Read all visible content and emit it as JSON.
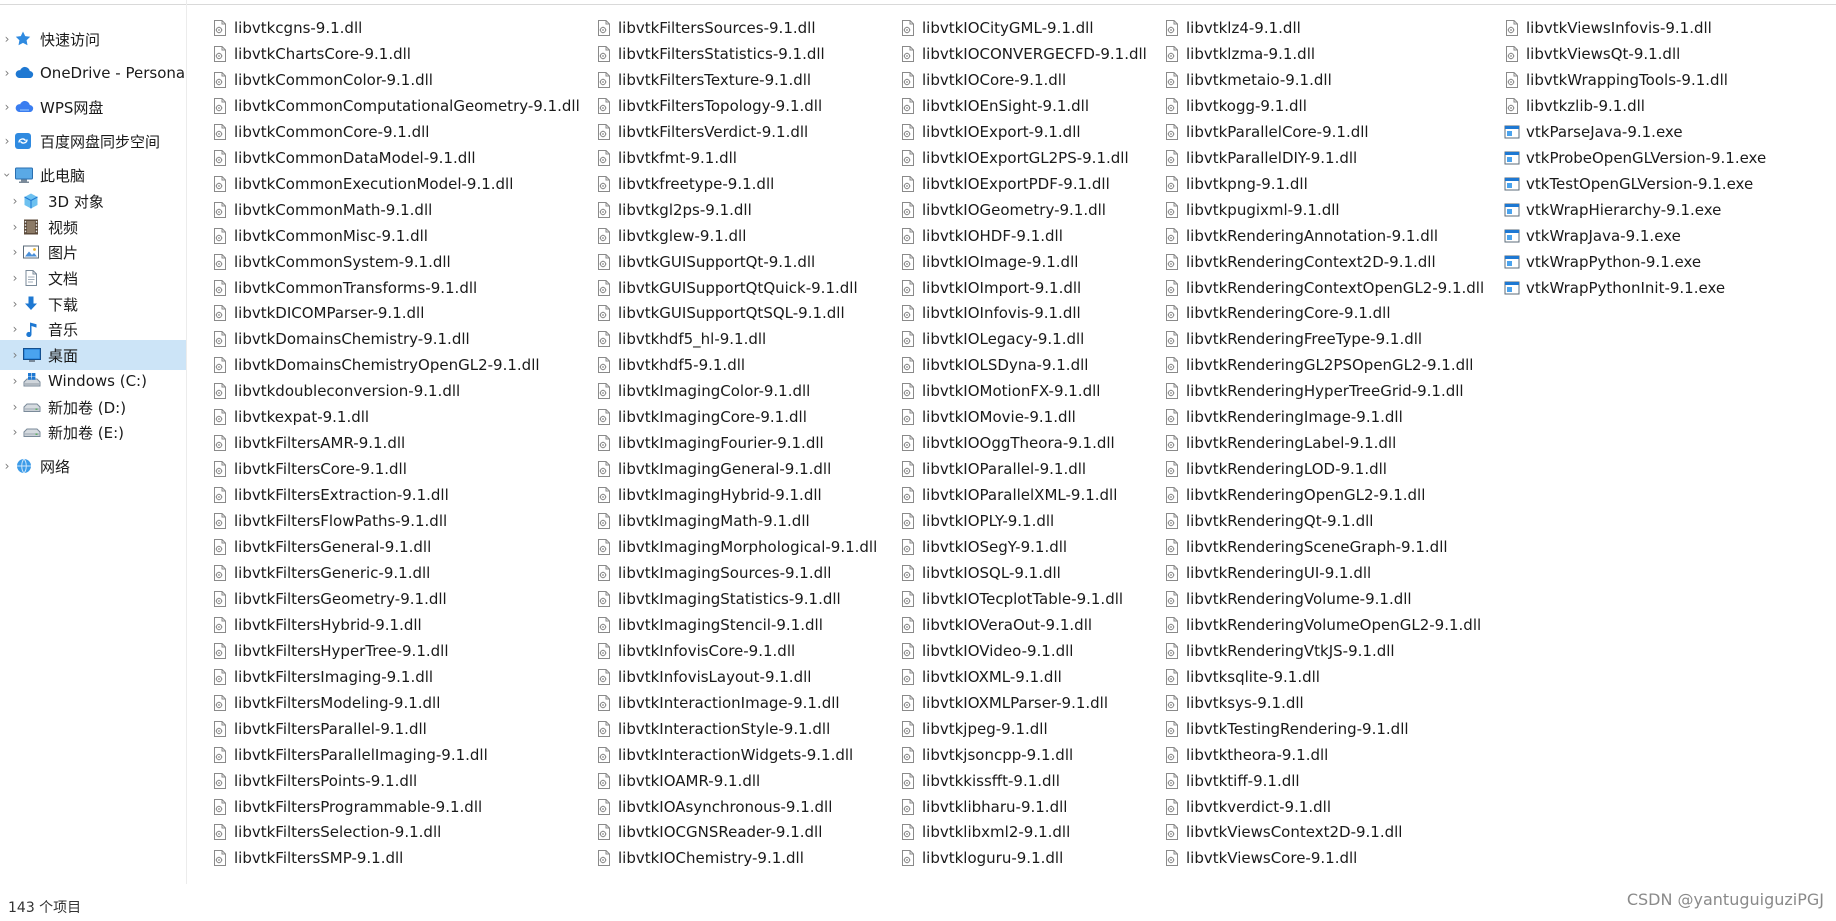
{
  "colors": {
    "selected_bg": "#cce4f7",
    "accent_blue": "#1e78d2",
    "text": "#1a1a1a",
    "watermark": "#8a8a8a"
  },
  "sidebar": {
    "items": [
      {
        "label": "快速访问",
        "icon": "star-icon",
        "expander": true,
        "expanded": false,
        "indent": 0,
        "selected": false
      },
      {
        "label": "OneDrive - Persona",
        "icon": "cloud-icon",
        "expander": true,
        "expanded": false,
        "indent": 0,
        "selected": false
      },
      {
        "label": "WPS网盘",
        "icon": "wps-cloud-icon",
        "expander": true,
        "expanded": false,
        "indent": 0,
        "selected": false
      },
      {
        "label": "百度网盘同步空间",
        "icon": "baidu-sync-icon",
        "expander": true,
        "expanded": false,
        "indent": 0,
        "selected": false
      },
      {
        "label": "此电脑",
        "icon": "computer-icon",
        "expander": true,
        "expanded": true,
        "indent": 0,
        "selected": false
      },
      {
        "label": "3D 对象",
        "icon": "cube-icon",
        "expander": true,
        "expanded": false,
        "indent": 1,
        "selected": false
      },
      {
        "label": "视频",
        "icon": "film-icon",
        "expander": true,
        "expanded": false,
        "indent": 1,
        "selected": false
      },
      {
        "label": "图片",
        "icon": "picture-icon",
        "expander": true,
        "expanded": false,
        "indent": 1,
        "selected": false
      },
      {
        "label": "文档",
        "icon": "document-icon",
        "expander": true,
        "expanded": false,
        "indent": 1,
        "selected": false
      },
      {
        "label": "下载",
        "icon": "download-arrow-icon",
        "expander": true,
        "expanded": false,
        "indent": 1,
        "selected": false
      },
      {
        "label": "音乐",
        "icon": "music-note-icon",
        "expander": true,
        "expanded": false,
        "indent": 1,
        "selected": false
      },
      {
        "label": "桌面",
        "icon": "desktop-icon",
        "expander": true,
        "expanded": false,
        "indent": 1,
        "selected": true
      },
      {
        "label": "Windows (C:)",
        "icon": "windows-drive-icon",
        "expander": true,
        "expanded": false,
        "indent": 1,
        "selected": false
      },
      {
        "label": "新加卷 (D:)",
        "icon": "drive-icon",
        "expander": true,
        "expanded": false,
        "indent": 1,
        "selected": false
      },
      {
        "label": "新加卷 (E:)",
        "icon": "drive-icon",
        "expander": true,
        "expanded": false,
        "indent": 1,
        "selected": false
      },
      {
        "label": "网络",
        "icon": "network-icon",
        "expander": true,
        "expanded": false,
        "indent": 0,
        "selected": false
      }
    ]
  },
  "files": {
    "columns": [
      [
        {
          "name": "libvtkcgns-9.1.dll",
          "type": "dll"
        },
        {
          "name": "libvtkChartsCore-9.1.dll",
          "type": "dll"
        },
        {
          "name": "libvtkCommonColor-9.1.dll",
          "type": "dll"
        },
        {
          "name": "libvtkCommonComputationalGeometry-9.1.dll",
          "type": "dll"
        },
        {
          "name": "libvtkCommonCore-9.1.dll",
          "type": "dll"
        },
        {
          "name": "libvtkCommonDataModel-9.1.dll",
          "type": "dll"
        },
        {
          "name": "libvtkCommonExecutionModel-9.1.dll",
          "type": "dll"
        },
        {
          "name": "libvtkCommonMath-9.1.dll",
          "type": "dll"
        },
        {
          "name": "libvtkCommonMisc-9.1.dll",
          "type": "dll"
        },
        {
          "name": "libvtkCommonSystem-9.1.dll",
          "type": "dll"
        },
        {
          "name": "libvtkCommonTransforms-9.1.dll",
          "type": "dll"
        },
        {
          "name": "libvtkDICOMParser-9.1.dll",
          "type": "dll"
        },
        {
          "name": "libvtkDomainsChemistry-9.1.dll",
          "type": "dll"
        },
        {
          "name": "libvtkDomainsChemistryOpenGL2-9.1.dll",
          "type": "dll"
        },
        {
          "name": "libvtkdoubleconversion-9.1.dll",
          "type": "dll"
        },
        {
          "name": "libvtkexpat-9.1.dll",
          "type": "dll"
        },
        {
          "name": "libvtkFiltersAMR-9.1.dll",
          "type": "dll"
        },
        {
          "name": "libvtkFiltersCore-9.1.dll",
          "type": "dll"
        },
        {
          "name": "libvtkFiltersExtraction-9.1.dll",
          "type": "dll"
        },
        {
          "name": "libvtkFiltersFlowPaths-9.1.dll",
          "type": "dll"
        },
        {
          "name": "libvtkFiltersGeneral-9.1.dll",
          "type": "dll"
        },
        {
          "name": "libvtkFiltersGeneric-9.1.dll",
          "type": "dll"
        },
        {
          "name": "libvtkFiltersGeometry-9.1.dll",
          "type": "dll"
        },
        {
          "name": "libvtkFiltersHybrid-9.1.dll",
          "type": "dll"
        },
        {
          "name": "libvtkFiltersHyperTree-9.1.dll",
          "type": "dll"
        },
        {
          "name": "libvtkFiltersImaging-9.1.dll",
          "type": "dll"
        },
        {
          "name": "libvtkFiltersModeling-9.1.dll",
          "type": "dll"
        },
        {
          "name": "libvtkFiltersParallel-9.1.dll",
          "type": "dll"
        },
        {
          "name": "libvtkFiltersParallelImaging-9.1.dll",
          "type": "dll"
        },
        {
          "name": "libvtkFiltersPoints-9.1.dll",
          "type": "dll"
        },
        {
          "name": "libvtkFiltersProgrammable-9.1.dll",
          "type": "dll"
        },
        {
          "name": "libvtkFiltersSelection-9.1.dll",
          "type": "dll"
        },
        {
          "name": "libvtkFiltersSMP-9.1.dll",
          "type": "dll"
        }
      ],
      [
        {
          "name": "libvtkFiltersSources-9.1.dll",
          "type": "dll"
        },
        {
          "name": "libvtkFiltersStatistics-9.1.dll",
          "type": "dll"
        },
        {
          "name": "libvtkFiltersTexture-9.1.dll",
          "type": "dll"
        },
        {
          "name": "libvtkFiltersTopology-9.1.dll",
          "type": "dll"
        },
        {
          "name": "libvtkFiltersVerdict-9.1.dll",
          "type": "dll"
        },
        {
          "name": "libvtkfmt-9.1.dll",
          "type": "dll"
        },
        {
          "name": "libvtkfreetype-9.1.dll",
          "type": "dll"
        },
        {
          "name": "libvtkgl2ps-9.1.dll",
          "type": "dll"
        },
        {
          "name": "libvtkglew-9.1.dll",
          "type": "dll"
        },
        {
          "name": "libvtkGUISupportQt-9.1.dll",
          "type": "dll"
        },
        {
          "name": "libvtkGUISupportQtQuick-9.1.dll",
          "type": "dll"
        },
        {
          "name": "libvtkGUISupportQtSQL-9.1.dll",
          "type": "dll"
        },
        {
          "name": "libvtkhdf5_hl-9.1.dll",
          "type": "dll"
        },
        {
          "name": "libvtkhdf5-9.1.dll",
          "type": "dll"
        },
        {
          "name": "libvtkImagingColor-9.1.dll",
          "type": "dll"
        },
        {
          "name": "libvtkImagingCore-9.1.dll",
          "type": "dll"
        },
        {
          "name": "libvtkImagingFourier-9.1.dll",
          "type": "dll"
        },
        {
          "name": "libvtkImagingGeneral-9.1.dll",
          "type": "dll"
        },
        {
          "name": "libvtkImagingHybrid-9.1.dll",
          "type": "dll"
        },
        {
          "name": "libvtkImagingMath-9.1.dll",
          "type": "dll"
        },
        {
          "name": "libvtkImagingMorphological-9.1.dll",
          "type": "dll"
        },
        {
          "name": "libvtkImagingSources-9.1.dll",
          "type": "dll"
        },
        {
          "name": "libvtkImagingStatistics-9.1.dll",
          "type": "dll"
        },
        {
          "name": "libvtkImagingStencil-9.1.dll",
          "type": "dll"
        },
        {
          "name": "libvtkInfovisCore-9.1.dll",
          "type": "dll"
        },
        {
          "name": "libvtkInfovisLayout-9.1.dll",
          "type": "dll"
        },
        {
          "name": "libvtkInteractionImage-9.1.dll",
          "type": "dll"
        },
        {
          "name": "libvtkInteractionStyle-9.1.dll",
          "type": "dll"
        },
        {
          "name": "libvtkInteractionWidgets-9.1.dll",
          "type": "dll"
        },
        {
          "name": "libvtkIOAMR-9.1.dll",
          "type": "dll"
        },
        {
          "name": "libvtkIOAsynchronous-9.1.dll",
          "type": "dll"
        },
        {
          "name": "libvtkIOCGNSReader-9.1.dll",
          "type": "dll"
        },
        {
          "name": "libvtkIOChemistry-9.1.dll",
          "type": "dll"
        }
      ],
      [
        {
          "name": "libvtkIOCityGML-9.1.dll",
          "type": "dll"
        },
        {
          "name": "libvtkIOCONVERGECFD-9.1.dll",
          "type": "dll"
        },
        {
          "name": "libvtkIOCore-9.1.dll",
          "type": "dll"
        },
        {
          "name": "libvtkIOEnSight-9.1.dll",
          "type": "dll"
        },
        {
          "name": "libvtkIOExport-9.1.dll",
          "type": "dll"
        },
        {
          "name": "libvtkIOExportGL2PS-9.1.dll",
          "type": "dll"
        },
        {
          "name": "libvtkIOExportPDF-9.1.dll",
          "type": "dll"
        },
        {
          "name": "libvtkIOGeometry-9.1.dll",
          "type": "dll"
        },
        {
          "name": "libvtkIOHDF-9.1.dll",
          "type": "dll"
        },
        {
          "name": "libvtkIOImage-9.1.dll",
          "type": "dll"
        },
        {
          "name": "libvtkIOImport-9.1.dll",
          "type": "dll"
        },
        {
          "name": "libvtkIOInfovis-9.1.dll",
          "type": "dll"
        },
        {
          "name": "libvtkIOLegacy-9.1.dll",
          "type": "dll"
        },
        {
          "name": "libvtkIOLSDyna-9.1.dll",
          "type": "dll"
        },
        {
          "name": "libvtkIOMotionFX-9.1.dll",
          "type": "dll"
        },
        {
          "name": "libvtkIOMovie-9.1.dll",
          "type": "dll"
        },
        {
          "name": "libvtkIOOggTheora-9.1.dll",
          "type": "dll"
        },
        {
          "name": "libvtkIOParallel-9.1.dll",
          "type": "dll"
        },
        {
          "name": "libvtkIOParallelXML-9.1.dll",
          "type": "dll"
        },
        {
          "name": "libvtkIOPLY-9.1.dll",
          "type": "dll"
        },
        {
          "name": "libvtkIOSegY-9.1.dll",
          "type": "dll"
        },
        {
          "name": "libvtkIOSQL-9.1.dll",
          "type": "dll"
        },
        {
          "name": "libvtkIOTecplotTable-9.1.dll",
          "type": "dll"
        },
        {
          "name": "libvtkIOVeraOut-9.1.dll",
          "type": "dll"
        },
        {
          "name": "libvtkIOVideo-9.1.dll",
          "type": "dll"
        },
        {
          "name": "libvtkIOXML-9.1.dll",
          "type": "dll"
        },
        {
          "name": "libvtkIOXMLParser-9.1.dll",
          "type": "dll"
        },
        {
          "name": "libvtkjpeg-9.1.dll",
          "type": "dll"
        },
        {
          "name": "libvtkjsoncpp-9.1.dll",
          "type": "dll"
        },
        {
          "name": "libvtkkissfft-9.1.dll",
          "type": "dll"
        },
        {
          "name": "libvtklibharu-9.1.dll",
          "type": "dll"
        },
        {
          "name": "libvtklibxml2-9.1.dll",
          "type": "dll"
        },
        {
          "name": "libvtkloguru-9.1.dll",
          "type": "dll"
        }
      ],
      [
        {
          "name": "libvtklz4-9.1.dll",
          "type": "dll"
        },
        {
          "name": "libvtklzma-9.1.dll",
          "type": "dll"
        },
        {
          "name": "libvtkmetaio-9.1.dll",
          "type": "dll"
        },
        {
          "name": "libvtkogg-9.1.dll",
          "type": "dll"
        },
        {
          "name": "libvtkParallelCore-9.1.dll",
          "type": "dll"
        },
        {
          "name": "libvtkParallelDIY-9.1.dll",
          "type": "dll"
        },
        {
          "name": "libvtkpng-9.1.dll",
          "type": "dll"
        },
        {
          "name": "libvtkpugixml-9.1.dll",
          "type": "dll"
        },
        {
          "name": "libvtkRenderingAnnotation-9.1.dll",
          "type": "dll"
        },
        {
          "name": "libvtkRenderingContext2D-9.1.dll",
          "type": "dll"
        },
        {
          "name": "libvtkRenderingContextOpenGL2-9.1.dll",
          "type": "dll"
        },
        {
          "name": "libvtkRenderingCore-9.1.dll",
          "type": "dll"
        },
        {
          "name": "libvtkRenderingFreeType-9.1.dll",
          "type": "dll"
        },
        {
          "name": "libvtkRenderingGL2PSOpenGL2-9.1.dll",
          "type": "dll"
        },
        {
          "name": "libvtkRenderingHyperTreeGrid-9.1.dll",
          "type": "dll"
        },
        {
          "name": "libvtkRenderingImage-9.1.dll",
          "type": "dll"
        },
        {
          "name": "libvtkRenderingLabel-9.1.dll",
          "type": "dll"
        },
        {
          "name": "libvtkRenderingLOD-9.1.dll",
          "type": "dll"
        },
        {
          "name": "libvtkRenderingOpenGL2-9.1.dll",
          "type": "dll"
        },
        {
          "name": "libvtkRenderingQt-9.1.dll",
          "type": "dll"
        },
        {
          "name": "libvtkRenderingSceneGraph-9.1.dll",
          "type": "dll"
        },
        {
          "name": "libvtkRenderingUI-9.1.dll",
          "type": "dll"
        },
        {
          "name": "libvtkRenderingVolume-9.1.dll",
          "type": "dll"
        },
        {
          "name": "libvtkRenderingVolumeOpenGL2-9.1.dll",
          "type": "dll"
        },
        {
          "name": "libvtkRenderingVtkJS-9.1.dll",
          "type": "dll"
        },
        {
          "name": "libvtksqlite-9.1.dll",
          "type": "dll"
        },
        {
          "name": "libvtksys-9.1.dll",
          "type": "dll"
        },
        {
          "name": "libvtkTestingRendering-9.1.dll",
          "type": "dll"
        },
        {
          "name": "libvtktheora-9.1.dll",
          "type": "dll"
        },
        {
          "name": "libvtktiff-9.1.dll",
          "type": "dll"
        },
        {
          "name": "libvtkverdict-9.1.dll",
          "type": "dll"
        },
        {
          "name": "libvtkViewsContext2D-9.1.dll",
          "type": "dll"
        },
        {
          "name": "libvtkViewsCore-9.1.dll",
          "type": "dll"
        }
      ],
      [
        {
          "name": "libvtkViewsInfovis-9.1.dll",
          "type": "dll"
        },
        {
          "name": "libvtkViewsQt-9.1.dll",
          "type": "dll"
        },
        {
          "name": "libvtkWrappingTools-9.1.dll",
          "type": "dll"
        },
        {
          "name": "libvtkzlib-9.1.dll",
          "type": "dll"
        },
        {
          "name": "vtkParseJava-9.1.exe",
          "type": "exe"
        },
        {
          "name": "vtkProbeOpenGLVersion-9.1.exe",
          "type": "exe"
        },
        {
          "name": "vtkTestOpenGLVersion-9.1.exe",
          "type": "exe"
        },
        {
          "name": "vtkWrapHierarchy-9.1.exe",
          "type": "exe"
        },
        {
          "name": "vtkWrapJava-9.1.exe",
          "type": "exe"
        },
        {
          "name": "vtkWrapPython-9.1.exe",
          "type": "exe"
        },
        {
          "name": "vtkWrapPythonInit-9.1.exe",
          "type": "exe"
        }
      ]
    ]
  },
  "status_bar": {
    "item_count": "143 个项目"
  },
  "watermark": {
    "text": "CSDN @yantuguiguziPGJ"
  }
}
